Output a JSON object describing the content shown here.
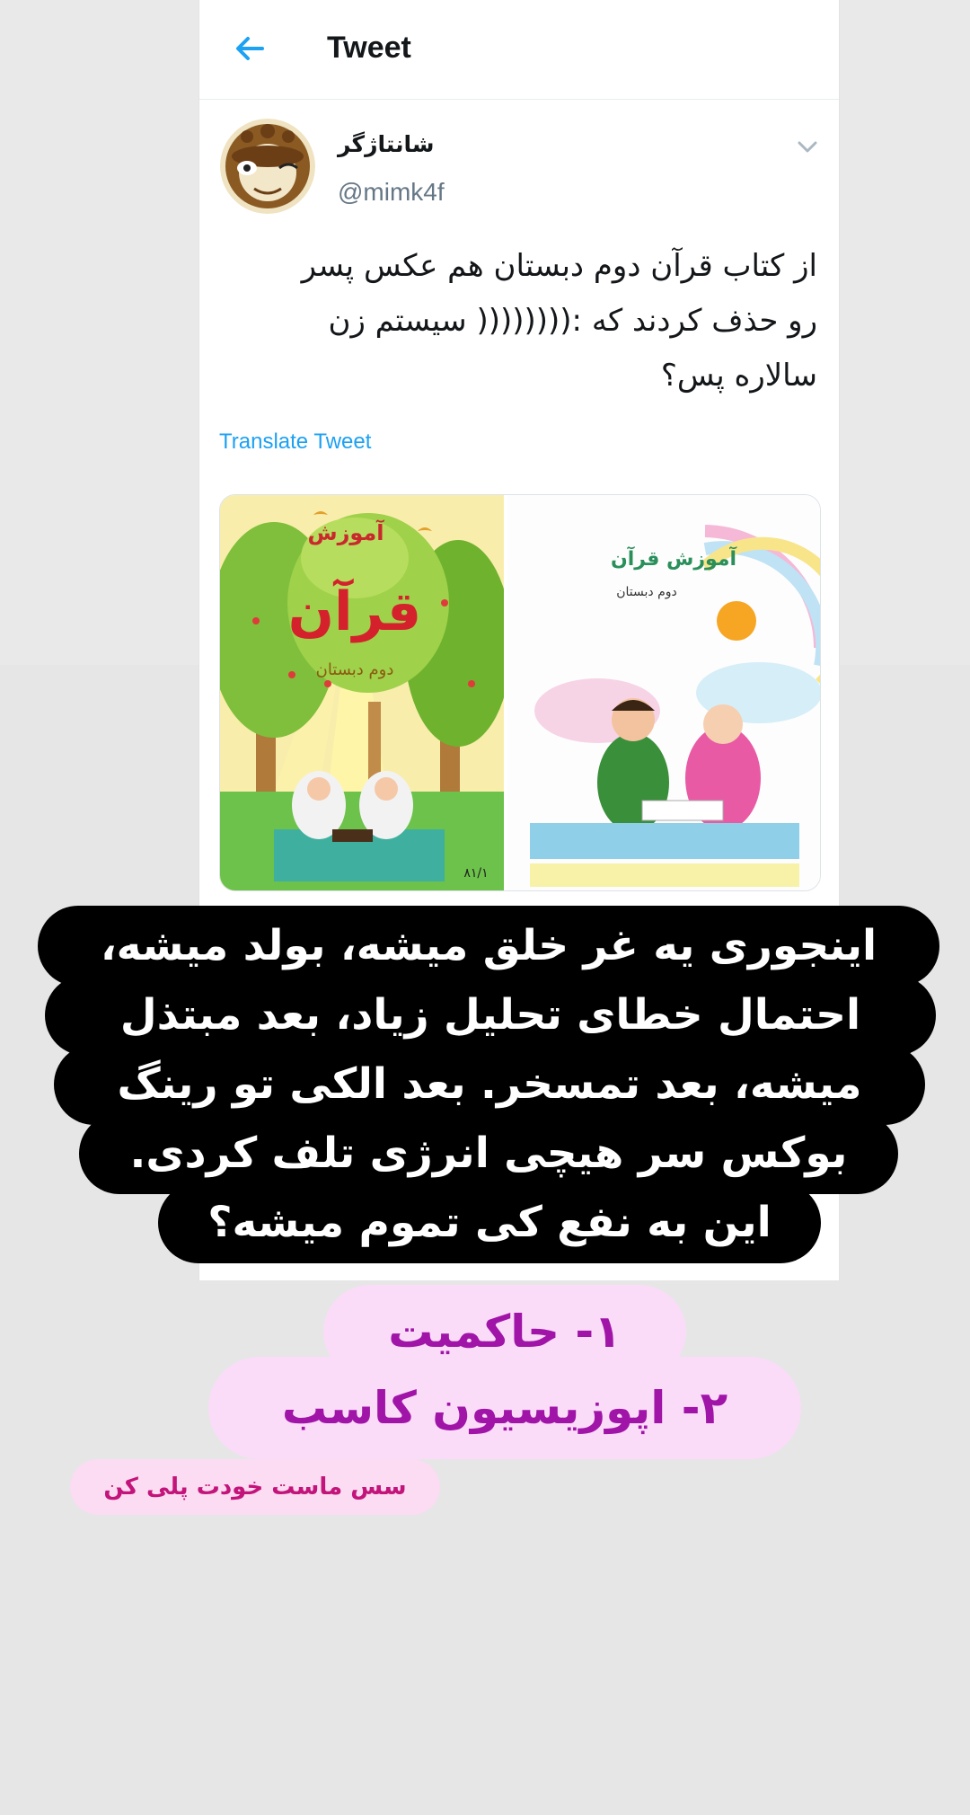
{
  "header": {
    "title": "Tweet",
    "back_icon": "arrow-left-icon"
  },
  "tweet": {
    "display_name": "شانتاژگر",
    "handle": "@mimk4f",
    "text_lines": [
      "از کتاب قرآن دوم دبستان هم عکس پسر",
      "رو حذف کردند که :(((((((( سیستم زن",
      "سالاره پس؟"
    ],
    "translate_label": "Translate Tweet",
    "menu_icon": "chevron-down-icon"
  },
  "media": {
    "left_book": {
      "title_small": "آموزش",
      "title_big": "قرآن",
      "subtitle": "دوم دبستان",
      "code": "۸۱/۱"
    },
    "right_book": {
      "title": "آموزش قرآن",
      "subtitle": "دوم دبستان"
    }
  },
  "overlay": {
    "lines": [
      "اینجوری یه غر خلق میشه، بولد میشه،",
      "احتمال خطای تحلیل زیاد، بعد مبتذل",
      "میشه، بعد تمسخر. بعد الکی تو رینگ",
      "بوکس سر هیچی انرژی تلف کردی.",
      "این به نفع کی تموم میشه؟"
    ],
    "answers": [
      "۱- حاکمیت",
      "۲- اپوزیسیون کاسب"
    ],
    "footnote": "سس ماست خودت پلی کن"
  },
  "colors": {
    "link": "#1da1f2",
    "overlay_bg": "#000000",
    "answer_pill": "#fadcf8",
    "answer_text": "#a014a8",
    "footnote_text": "#c2147a"
  }
}
